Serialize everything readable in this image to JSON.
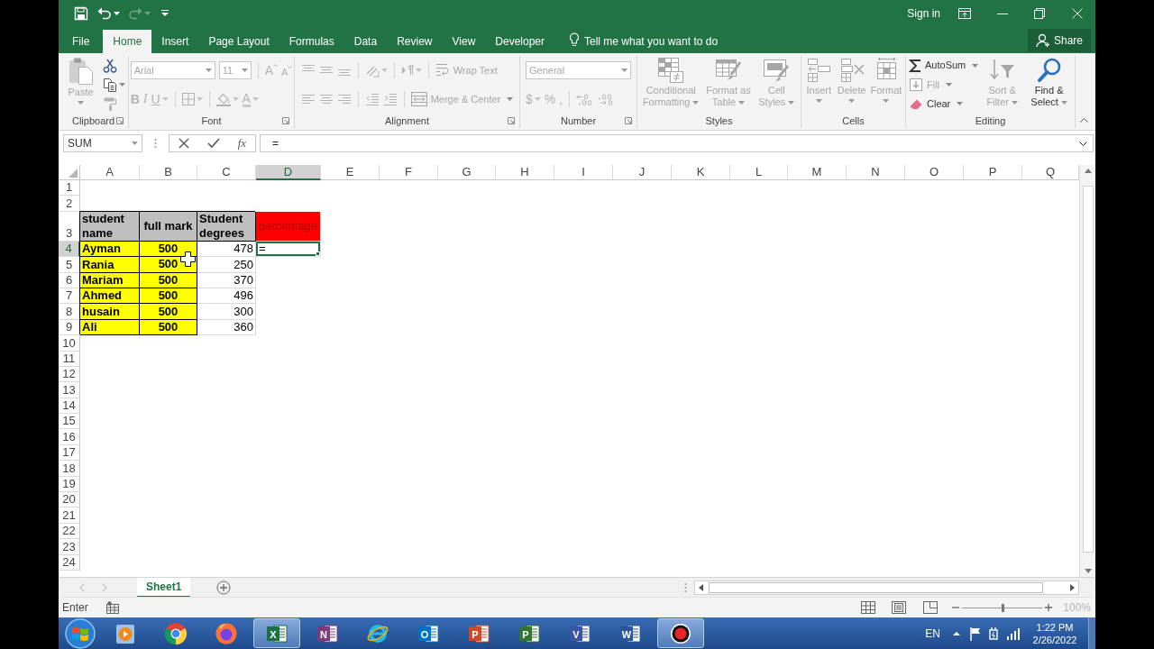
{
  "title_bar": {
    "quick_access": [
      {
        "kind": "save",
        "disabled": false
      },
      {
        "kind": "undo",
        "disabled": false
      },
      {
        "kind": "redo",
        "disabled": true
      },
      {
        "kind": "customize",
        "disabled": false
      }
    ],
    "sign_in": "Sign in"
  },
  "tabs": [
    {
      "label": "File",
      "selected": false
    },
    {
      "label": "Home",
      "selected": true
    },
    {
      "label": "Insert",
      "selected": false
    },
    {
      "label": "Page Layout",
      "selected": false
    },
    {
      "label": "Formulas",
      "selected": false
    },
    {
      "label": "Data",
      "selected": false
    },
    {
      "label": "Review",
      "selected": false
    },
    {
      "label": "View",
      "selected": false
    },
    {
      "label": "Developer",
      "selected": false
    }
  ],
  "tell_me": {
    "placeholder": "Tell me what you want to do"
  },
  "share_button": "Share",
  "ribbon": {
    "groups": [
      {
        "label": "Clipboard",
        "launcher": true,
        "sections": [
          {
            "kind": "large",
            "buttons": [
              {
                "kind": "paste",
                "label": "Paste",
                "disabled": true
              }
            ]
          },
          {
            "kind": "rows",
            "rows": [
              [
                [
                  {
                    "kind": "cut",
                    "disabled": false
                  }
                ]
              ],
              [
                [
                  {
                    "kind": "copy",
                    "disabled": false
                  }
                ]
              ],
              [
                [
                  {
                    "kind": "painter",
                    "disabled": true
                  }
                ]
              ]
            ]
          }
        ]
      },
      {
        "label": "Font",
        "launcher": true,
        "sections": [
          {
            "kind": "rows",
            "rows": [
              [
                [
                  {
                    "kind": "font_name",
                    "value": "Arial",
                    "disabled": true
                  },
                  {
                    "kind": "font_size",
                    "value": "11",
                    "disabled": true
                  }
                ],
                [
                  {
                    "kind": "grow",
                    "label": "A",
                    "disabled": true
                  },
                  {
                    "kind": "shrink",
                    "label": "A",
                    "disabled": true
                  }
                ]
              ],
              [
                [
                  {
                    "kind": "bold",
                    "label": "B",
                    "disabled": true
                  },
                  {
                    "kind": "italic",
                    "label": "I",
                    "disabled": true
                  },
                  {
                    "kind": "underline",
                    "label": "U",
                    "disabled": true
                  }
                ],
                [
                  {
                    "kind": "borders",
                    "disabled": true
                  }
                ],
                [
                  {
                    "kind": "fill_color",
                    "disabled": true
                  },
                  {
                    "kind": "font_color",
                    "label": "A",
                    "disabled": true
                  }
                ]
              ]
            ]
          }
        ]
      },
      {
        "label": "Alignment",
        "launcher": true,
        "sections": [
          {
            "kind": "rows",
            "rows": [
              [
                [
                  {
                    "kind": "align_top",
                    "disabled": true
                  },
                  {
                    "kind": "align_middle",
                    "disabled": true
                  },
                  {
                    "kind": "align_bottom",
                    "disabled": true
                  }
                ],
                [
                  {
                    "kind": "orientation",
                    "disabled": true
                  }
                ],
                [
                  {
                    "kind": "direction",
                    "disabled": true
                  }
                ],
                [
                  {
                    "kind": "wrap",
                    "label": "Wrap Text",
                    "disabled": true
                  }
                ]
              ],
              [
                [
                  {
                    "kind": "align_left",
                    "disabled": true
                  },
                  {
                    "kind": "align_center",
                    "disabled": true
                  },
                  {
                    "kind": "align_right",
                    "disabled": true
                  }
                ],
                [
                  {
                    "kind": "outdent",
                    "disabled": true
                  },
                  {
                    "kind": "indent",
                    "disabled": true
                  }
                ],
                [
                  {
                    "kind": "merge",
                    "label": "Merge & Center",
                    "disabled": true
                  }
                ]
              ]
            ]
          }
        ]
      },
      {
        "label": "Number",
        "launcher": true,
        "sections": [
          {
            "kind": "rows",
            "rows": [
              [
                [
                  {
                    "kind": "number_format",
                    "value": "General",
                    "disabled": true
                  }
                ]
              ],
              [
                [
                  {
                    "kind": "currency",
                    "label": "$",
                    "disabled": true
                  },
                  {
                    "kind": "percent",
                    "label": "%",
                    "disabled": true
                  },
                  {
                    "kind": "comma",
                    "label": ",",
                    "disabled": true
                  }
                ],
                [
                  {
                    "kind": "more_decimals",
                    "disabled": true
                  },
                  {
                    "kind": "fewer_decimals",
                    "disabled": true
                  }
                ]
              ]
            ]
          }
        ]
      },
      {
        "label": "Styles",
        "launcher": false,
        "sections": [
          {
            "kind": "large",
            "buttons": [
              {
                "kind": "conditional",
                "label": "Conditional Formatting",
                "disabled": true
              },
              {
                "kind": "as_table",
                "label": "Format as Table",
                "disabled": true
              },
              {
                "kind": "cell_styles",
                "label": "Cell Styles",
                "disabled": true
              }
            ]
          }
        ]
      },
      {
        "label": "Cells",
        "launcher": false,
        "sections": [
          {
            "kind": "large",
            "buttons": [
              {
                "kind": "insert",
                "label": "Insert",
                "disabled": true
              },
              {
                "kind": "delete",
                "label": "Delete",
                "disabled": true
              },
              {
                "kind": "format",
                "label": "Format",
                "disabled": true
              }
            ]
          }
        ]
      },
      {
        "label": "Editing",
        "launcher": false,
        "sections": [
          {
            "kind": "rows",
            "rows": [
              [
                [
                  {
                    "kind": "autosum",
                    "label": "AutoSum",
                    "disabled": false
                  }
                ]
              ],
              [
                [
                  {
                    "kind": "fill_down",
                    "label": "Fill",
                    "disabled": true
                  }
                ]
              ],
              [
                [
                  {
                    "kind": "clear",
                    "label": "Clear",
                    "disabled": false
                  }
                ]
              ]
            ]
          },
          {
            "kind": "large",
            "buttons": [
              {
                "kind": "sort",
                "label": "Sort & Filter",
                "disabled": true
              },
              {
                "kind": "find",
                "label": "Find & Select",
                "disabled": false
              }
            ]
          }
        ]
      }
    ]
  },
  "formula_bar": {
    "name_box": "SUM",
    "insert_function": "fx",
    "formula": "="
  },
  "sheet": {
    "columns": [
      {
        "label": "A",
        "selected": false
      },
      {
        "label": "B",
        "selected": false
      },
      {
        "label": "C",
        "selected": false
      },
      {
        "label": "D",
        "selected": true
      },
      {
        "label": "E",
        "selected": false
      },
      {
        "label": "F",
        "selected": false
      },
      {
        "label": "G",
        "selected": false
      },
      {
        "label": "H",
        "selected": false
      },
      {
        "label": "I",
        "selected": false
      },
      {
        "label": "J",
        "selected": false
      },
      {
        "label": "K",
        "selected": false
      },
      {
        "label": "L",
        "selected": false
      },
      {
        "label": "M",
        "selected": false
      },
      {
        "label": "N",
        "selected": false
      },
      {
        "label": "O",
        "selected": false
      },
      {
        "label": "P",
        "selected": false
      },
      {
        "label": "Q",
        "selected": false
      }
    ],
    "rows": [
      {
        "label": "1",
        "selected": false
      },
      {
        "label": "2",
        "selected": false
      },
      {
        "label": "3",
        "selected": false,
        "cells": [
          {
            "text": "student name",
            "kind": "bold",
            "color": "#bfbfbf",
            "boxed": true,
            "selected": false
          },
          {
            "text": "full mark",
            "kind": "centered",
            "color": "#bfbfbf",
            "boxed": true,
            "selected": false
          },
          {
            "text": "Student degrees",
            "kind": "bold",
            "color": "#bfbfbf",
            "boxed": true,
            "selected": false
          },
          {
            "text": "percentage",
            "kind": "note",
            "color": "#ff0000",
            "boxed": false,
            "selected": false
          }
        ]
      },
      {
        "label": "4",
        "selected": true,
        "cells": [
          {
            "text": "Ayman",
            "kind": "bold",
            "color": "#ffff00",
            "boxed": true,
            "selected": false
          },
          {
            "text": "500",
            "kind": "centered",
            "color": "#ffff00",
            "boxed": true,
            "selected": false
          },
          {
            "text": "478",
            "kind": "number",
            "boxed": false,
            "selected": false
          },
          {
            "text": "=",
            "kind": "entry",
            "boxed": false,
            "selected": true
          }
        ]
      },
      {
        "label": "5",
        "selected": false,
        "cells": [
          {
            "text": "Rania",
            "kind": "bold",
            "color": "#ffff00",
            "boxed": true,
            "selected": false
          },
          {
            "text": "500",
            "kind": "centered",
            "color": "#ffff00",
            "boxed": true,
            "selected": false
          },
          {
            "text": "250",
            "kind": "number",
            "boxed": false,
            "selected": false
          }
        ]
      },
      {
        "label": "6",
        "selected": false,
        "cells": [
          {
            "text": "Mariam",
            "kind": "bold",
            "color": "#ffff00",
            "boxed": true,
            "selected": false
          },
          {
            "text": "500",
            "kind": "centered",
            "color": "#ffff00",
            "boxed": true,
            "selected": false
          },
          {
            "text": "370",
            "kind": "number",
            "boxed": false,
            "selected": false
          }
        ]
      },
      {
        "label": "7",
        "selected": false,
        "cells": [
          {
            "text": "Ahmed",
            "kind": "bold",
            "color": "#ffff00",
            "boxed": true,
            "selected": false
          },
          {
            "text": "500",
            "kind": "centered",
            "color": "#ffff00",
            "boxed": true,
            "selected": false
          },
          {
            "text": "496",
            "kind": "number",
            "boxed": false,
            "selected": false
          }
        ]
      },
      {
        "label": "8",
        "selected": false,
        "cells": [
          {
            "text": "husain",
            "kind": "bold",
            "color": "#ffff00",
            "boxed": true,
            "selected": false
          },
          {
            "text": "500",
            "kind": "centered",
            "color": "#ffff00",
            "boxed": true,
            "selected": false
          },
          {
            "text": "300",
            "kind": "number",
            "boxed": false,
            "selected": false
          }
        ]
      },
      {
        "label": "9",
        "selected": false,
        "cells": [
          {
            "text": "Ali",
            "kind": "bold",
            "color": "#ffff00",
            "boxed": true,
            "selected": false
          },
          {
            "text": "500",
            "kind": "centered",
            "color": "#ffff00",
            "boxed": true,
            "selected": false
          },
          {
            "text": "360",
            "kind": "number",
            "boxed": false,
            "selected": false
          }
        ]
      },
      {
        "label": "10",
        "selected": false
      },
      {
        "label": "11",
        "selected": false
      },
      {
        "label": "12",
        "selected": false
      },
      {
        "label": "13",
        "selected": false
      },
      {
        "label": "14",
        "selected": false
      },
      {
        "label": "15",
        "selected": false
      },
      {
        "label": "16",
        "selected": false
      },
      {
        "label": "17",
        "selected": false
      },
      {
        "label": "18",
        "selected": false
      },
      {
        "label": "19",
        "selected": false
      },
      {
        "label": "20",
        "selected": false
      },
      {
        "label": "21",
        "selected": false
      },
      {
        "label": "22",
        "selected": false
      },
      {
        "label": "23",
        "selected": false
      },
      {
        "label": "24",
        "selected": false
      }
    ]
  },
  "sheet_bar": {
    "nav": [
      {
        "kind": "previous",
        "disabled": true
      },
      {
        "kind": "next",
        "disabled": true
      }
    ],
    "tabs": [
      {
        "label": "Sheet1",
        "selected": true
      }
    ]
  },
  "status_bar": {
    "mode": "Enter",
    "zoom": {
      "level": 0.5,
      "reading": "100%",
      "disabled": true
    }
  },
  "taskbar": {
    "apps": [
      {
        "kind": "player",
        "active": false
      },
      {
        "kind": "chrome",
        "active": false
      },
      {
        "kind": "fox",
        "active": false
      },
      {
        "kind": "sheet",
        "letter": "X",
        "active": true
      },
      {
        "kind": "notes",
        "letter": "N",
        "active": false
      },
      {
        "kind": "browser",
        "active": false
      },
      {
        "kind": "mail",
        "letter": "O",
        "active": false
      },
      {
        "kind": "slides",
        "letter": "P",
        "active": false
      },
      {
        "kind": "project",
        "letter": "P",
        "active": false
      },
      {
        "kind": "diagram",
        "letter": "V",
        "active": false
      },
      {
        "kind": "document",
        "letter": "W",
        "active": false
      },
      {
        "kind": "recorder",
        "active": true
      }
    ],
    "language": "EN",
    "clock": {
      "time": "1:22 PM",
      "date": "2/26/2022"
    }
  }
}
